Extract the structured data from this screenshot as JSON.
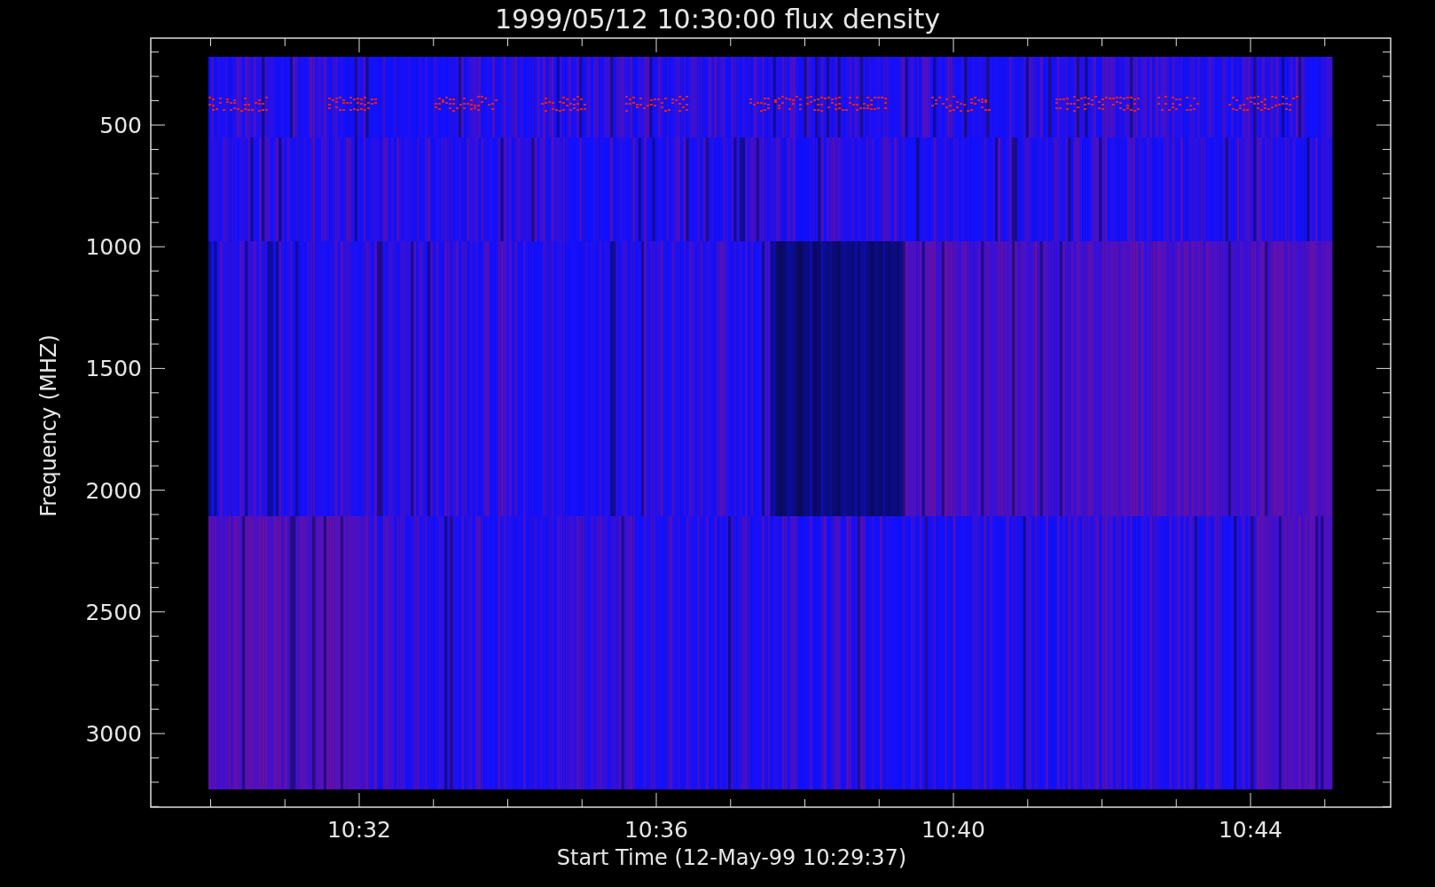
{
  "plot": {
    "title": "1999/05/12 10:30:00 flux density",
    "y_axis": {
      "label": "Frequency (MHZ)",
      "ticks": [
        "500",
        "1000",
        "1500",
        "2000",
        "2500",
        "3000"
      ]
    },
    "x_axis": {
      "label": "Start Time (12-May-99 10:29:37)",
      "ticks": [
        "10:32",
        "10:36",
        "10:40",
        "10:44"
      ]
    }
  }
}
